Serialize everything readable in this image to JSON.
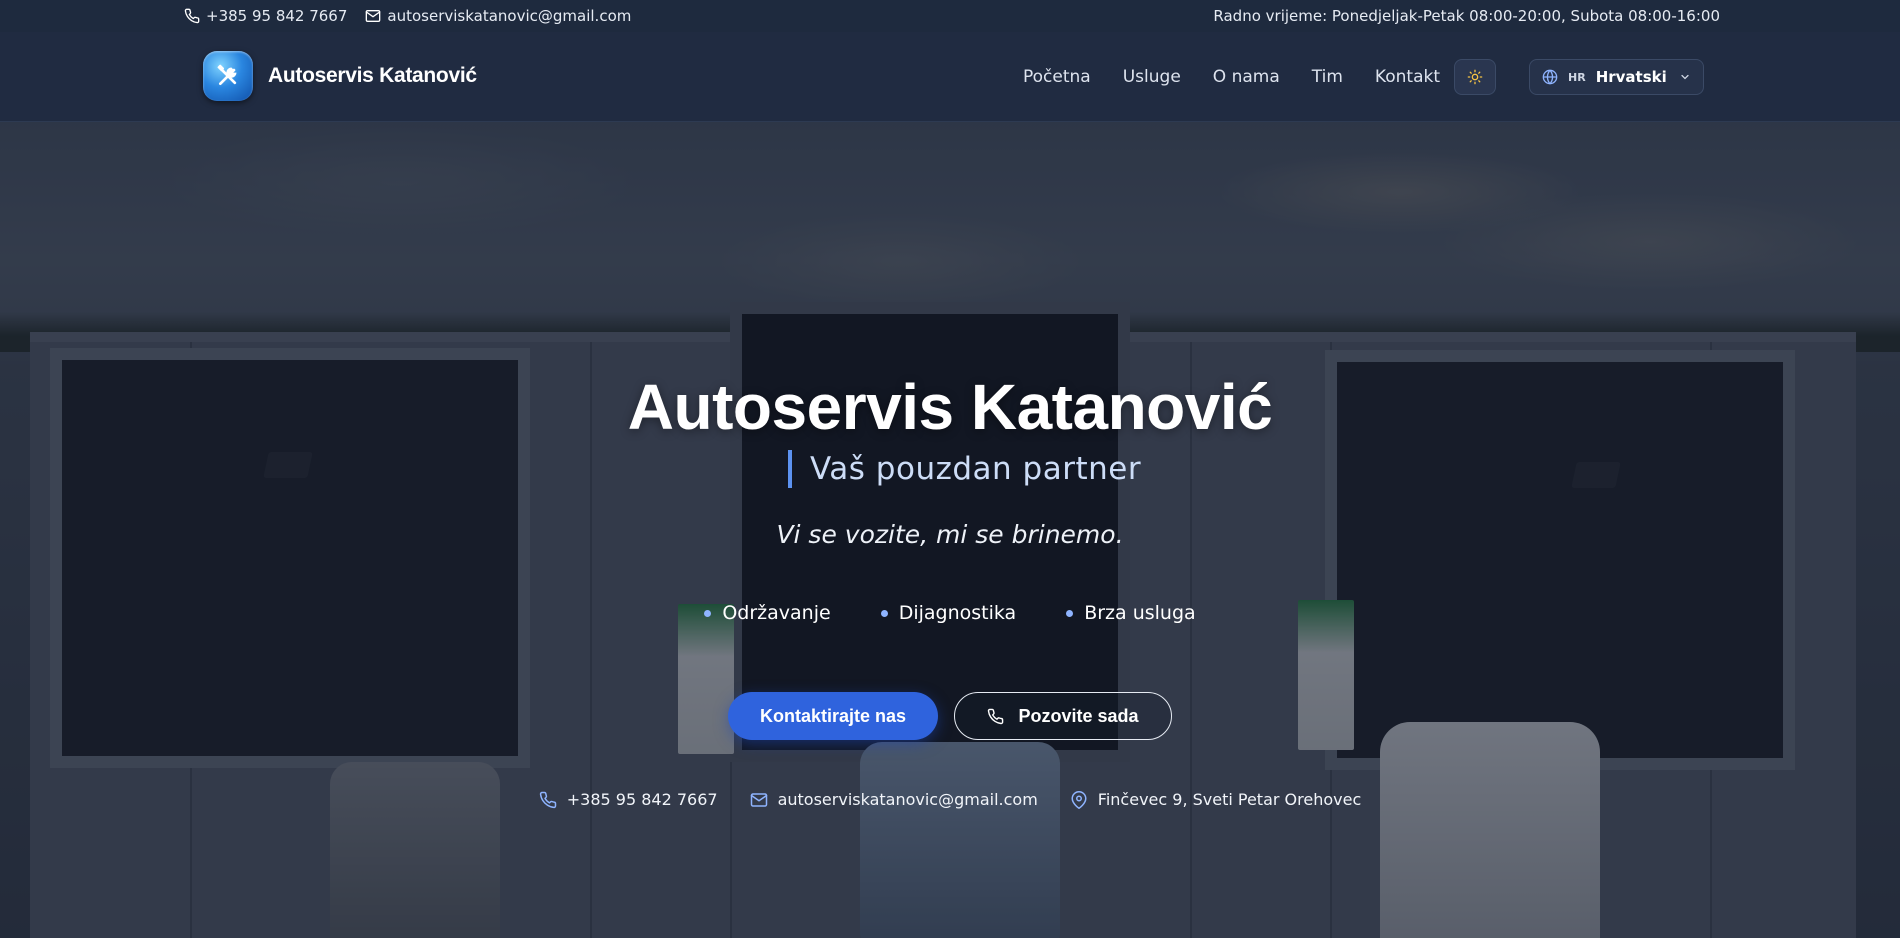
{
  "topbar": {
    "phone": "+385 95 842 7667",
    "email": "autoserviskatanovic@gmail.com",
    "hours": "Radno vrijeme: Ponedjeljak-Petak 08:00-20:00, Subota 08:00-16:00"
  },
  "header": {
    "brand": "Autoservis Katanović",
    "nav": [
      "Početna",
      "Usluge",
      "O nama",
      "Tim",
      "Kontakt"
    ],
    "language": {
      "code": "HR",
      "name": "Hrvatski"
    }
  },
  "hero": {
    "title": "Autoservis Katanović",
    "subtitle": "Vaš pouzdan partner",
    "slogan": "Vi se vozite, mi se brinemo.",
    "features": [
      "Održavanje",
      "Dijagnostika",
      "Brza usluga"
    ],
    "primary_button": "Kontaktirajte nas",
    "secondary_button": "Pozovite sada",
    "contacts": {
      "phone": "+385 95 842 7667",
      "email": "autoserviskatanovic@gmail.com",
      "address": "Finčevec 9, Sveti Petar Orehovec"
    }
  },
  "colors": {
    "primary": "#2f63dd",
    "accent": "#5c92f0",
    "header_bg": "#202b41",
    "topbar_bg": "#1e2a3e"
  },
  "icons": [
    "phone-icon",
    "mail-icon",
    "wrench-logo-icon",
    "sun-icon",
    "globe-icon",
    "chevron-down-icon",
    "map-pin-icon"
  ]
}
